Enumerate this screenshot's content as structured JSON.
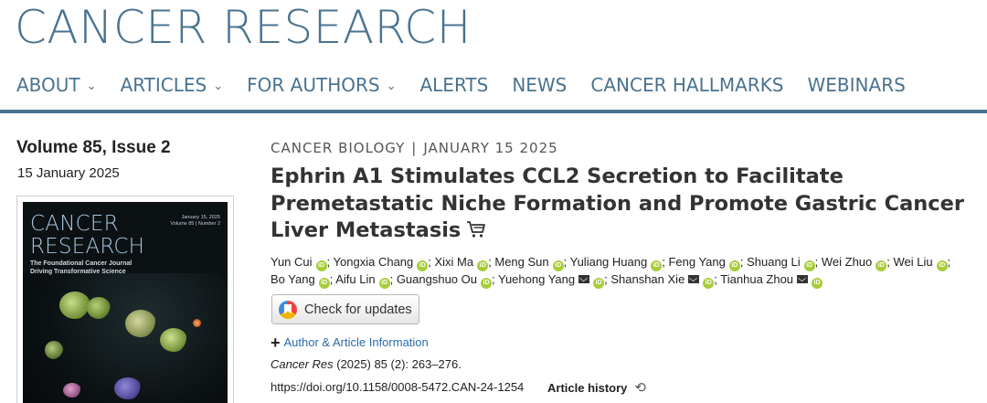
{
  "brand": "CANCER RESEARCH",
  "nav": [
    {
      "label": "ABOUT",
      "dropdown": true
    },
    {
      "label": "ARTICLES",
      "dropdown": true
    },
    {
      "label": "FOR AUTHORS",
      "dropdown": true
    },
    {
      "label": "ALERTS",
      "dropdown": false
    },
    {
      "label": "NEWS",
      "dropdown": false
    },
    {
      "label": "CANCER HALLMARKS",
      "dropdown": false
    },
    {
      "label": "WEBINARS",
      "dropdown": false
    }
  ],
  "issue": {
    "volume": "Volume 85, Issue 2",
    "date": "15 January 2025",
    "cover": {
      "title_line1": "CANCER",
      "title_line2": "RESEARCH",
      "date_line1": "January 15, 2025",
      "date_line2": "Volume 85 | Number 2",
      "tag_line1": "The Foundational Cancer Journal",
      "tag_line2": "Driving Transformative Science"
    }
  },
  "article": {
    "category": "CANCER BIOLOGY",
    "separator": "|",
    "date": "JANUARY 15 2025",
    "title": "Ephrin A1 Stimulates CCL2 Secretion to Facilitate Premetastatic Niche Formation and Promote Gastric Cancer Liver Metastasis",
    "authors": [
      {
        "name": "Yun Cui",
        "mail": false
      },
      {
        "name": "Yongxia Chang",
        "mail": false
      },
      {
        "name": "Xixi Ma",
        "mail": false
      },
      {
        "name": "Meng Sun",
        "mail": false
      },
      {
        "name": "Yuliang Huang",
        "mail": false
      },
      {
        "name": "Feng Yang",
        "mail": false
      },
      {
        "name": "Shuang Li",
        "mail": false
      },
      {
        "name": "Wei Zhuo",
        "mail": false
      },
      {
        "name": "Wei Liu",
        "mail": false
      },
      {
        "name": "Bo Yang",
        "mail": false
      },
      {
        "name": "Aifu Lin",
        "mail": false
      },
      {
        "name": "Guangshuo Ou",
        "mail": false
      },
      {
        "name": "Yuehong Yang",
        "mail": true
      },
      {
        "name": "Shanshan Xie",
        "mail": true
      },
      {
        "name": "Tianhua Zhou",
        "mail": true
      }
    ],
    "check_updates": "Check for updates",
    "author_info": "Author & Article Information",
    "citation_journal": "Cancer Res",
    "citation_rest": " (2025) 85 (2): 263–276.",
    "doi": "https://doi.org/10.1158/0008-5472.CAN-24-1254",
    "history": "Article history"
  },
  "colors": {
    "brand": "#4a7390",
    "orcid": "#a6ce39",
    "link": "#2a6ca8"
  }
}
